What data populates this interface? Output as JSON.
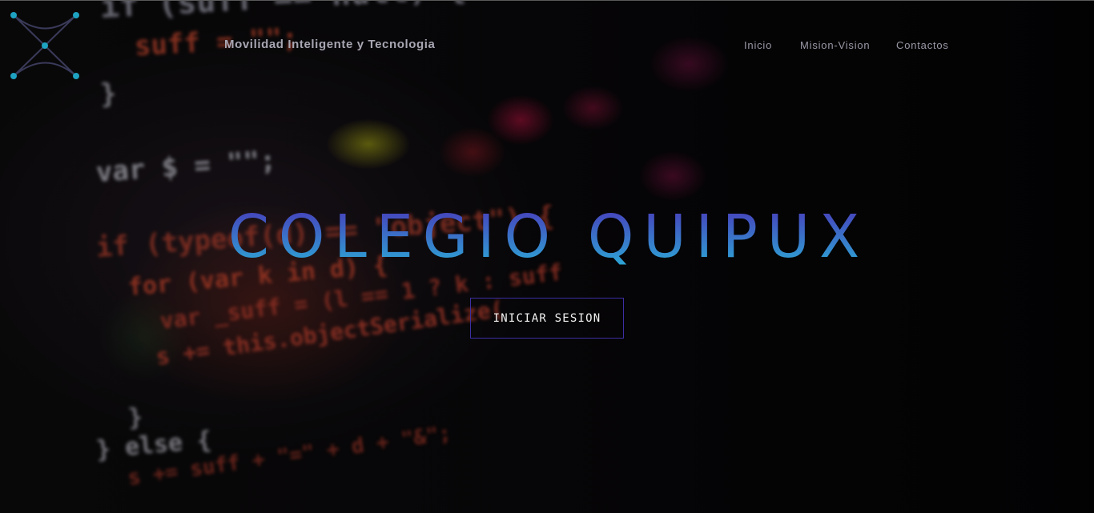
{
  "header": {
    "tagline": "Movilidad Inteligente y Tecnologia"
  },
  "nav": {
    "items": [
      {
        "label": "Inicio"
      },
      {
        "label": "Mision-Vision"
      },
      {
        "label": "Contactos"
      }
    ]
  },
  "hero": {
    "title": "COLEGIO QUIPUX",
    "button_label": "INICIAR SESION"
  },
  "colors": {
    "title_gradient_start": "#2ab0d8",
    "title_gradient_end": "#4a35b8",
    "button_border": "#3b2fa3",
    "logo_dot": "#1ea2c2"
  },
  "background": {
    "code_lines": [
      "if (suff == null) {",
      "suff = \"\";",
      "}",
      "var $ = \"\";",
      "if (typeof(d) == \"object\") {",
      "for (var k in d) {",
      "var _suff = (l == 1 ? k : suff",
      "s += this.objectSerialize(",
      "}",
      "} else {",
      "s += suff + \"=\" + d + \"&\";"
    ]
  }
}
